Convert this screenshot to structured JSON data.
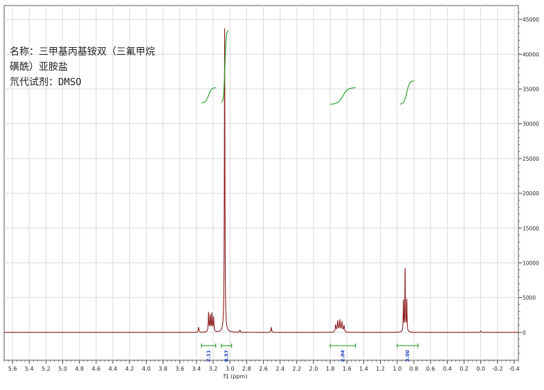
{
  "labels": {
    "line1": "名称：三甲基丙基铵双（三氟甲烷",
    "line2": "磺酰）亚胺盐",
    "line3": "氘代试剂：DMSO"
  },
  "chart_data": {
    "type": "line",
    "title": "",
    "xlabel": "f1 (ppm)",
    "ylabel": "",
    "xlim": [
      5.7,
      -0.45
    ],
    "ylim": [
      -4000,
      47000
    ],
    "x_ticks": [
      5.6,
      5.4,
      5.2,
      5.0,
      4.8,
      4.6,
      4.4,
      4.2,
      4.0,
      3.8,
      3.6,
      3.4,
      3.2,
      3.0,
      2.8,
      2.6,
      2.4,
      2.2,
      2.0,
      1.8,
      1.6,
      1.4,
      1.2,
      1.0,
      0.8,
      0.6,
      0.4,
      0.2,
      0.0,
      -0.2,
      -0.4
    ],
    "x_tick_labels": [
      "5.6",
      "5.4",
      "5.2",
      "5.0",
      "4.8",
      "4.6",
      "4.4",
      "4.2",
      "4.0",
      "3.8",
      "3.6",
      "3.4",
      "3.2",
      "3.0",
      "2.8",
      "2.6",
      "2.4",
      "2.2",
      "2.0",
      "1.8",
      "1.6",
      "1.4",
      "1.2",
      "1.0",
      "0.8",
      "0.6",
      "0.4",
      "0.2",
      "0.0",
      "-0.2",
      "-0.4"
    ],
    "y_ticks": [
      0,
      5000,
      10000,
      15000,
      20000,
      25000,
      30000,
      35000,
      40000,
      45000
    ],
    "y_tick_labels": [
      "0",
      "5000",
      "10000",
      "15000",
      "20000",
      "25000",
      "30000",
      "35000",
      "40000",
      "45000"
    ],
    "grid": true,
    "colors": {
      "spectrum": "#8b1a1a",
      "integral": "#2ca02c",
      "integral_value": "#1f3fbf",
      "grid": "#d9d9d9"
    },
    "peaks": [
      {
        "ppm": 3.375,
        "height": 700,
        "width": 0.005
      },
      {
        "ppm": 3.255,
        "height": 2700,
        "width": 0.0045
      },
      {
        "ppm": 3.235,
        "height": 2300,
        "width": 0.0045
      },
      {
        "ppm": 3.215,
        "height": 2600,
        "width": 0.0045
      },
      {
        "ppm": 3.195,
        "height": 2100,
        "width": 0.0045
      },
      {
        "ppm": 3.063,
        "height": 44000,
        "width": 0.004
      },
      {
        "ppm": 2.88,
        "height": 300,
        "width": 0.005
      },
      {
        "ppm": 2.505,
        "height": 700,
        "width": 0.005
      },
      {
        "ppm": 1.735,
        "height": 1000,
        "width": 0.006
      },
      {
        "ppm": 1.71,
        "height": 1500,
        "width": 0.006
      },
      {
        "ppm": 1.685,
        "height": 1600,
        "width": 0.006
      },
      {
        "ppm": 1.66,
        "height": 1400,
        "width": 0.006
      },
      {
        "ppm": 1.635,
        "height": 900,
        "width": 0.006
      },
      {
        "ppm": 0.925,
        "height": 4500,
        "width": 0.0035
      },
      {
        "ppm": 0.905,
        "height": 9000,
        "width": 0.0035
      },
      {
        "ppm": 0.885,
        "height": 4500,
        "width": 0.0035
      },
      {
        "ppm": 0.0,
        "height": 200,
        "width": 0.005
      }
    ],
    "integrals": [
      {
        "from": 3.34,
        "to": 3.17,
        "value": "2.11"
      },
      {
        "from": 3.1,
        "to": 2.98,
        "value": "8.57"
      },
      {
        "from": 1.8,
        "to": 1.5,
        "value": "2.04"
      },
      {
        "from": 1.0,
        "to": 0.75,
        "value": "3.00"
      }
    ],
    "integral_curves": [
      {
        "from": 3.34,
        "to": 3.17,
        "start": 33000,
        "end": 35200
      },
      {
        "from": 3.1,
        "to": 3.02,
        "start": 33000,
        "end": 43500
      },
      {
        "from": 1.8,
        "to": 1.5,
        "start": 32800,
        "end": 35200
      },
      {
        "from": 0.97,
        "to": 0.8,
        "start": 32800,
        "end": 36200
      }
    ]
  }
}
